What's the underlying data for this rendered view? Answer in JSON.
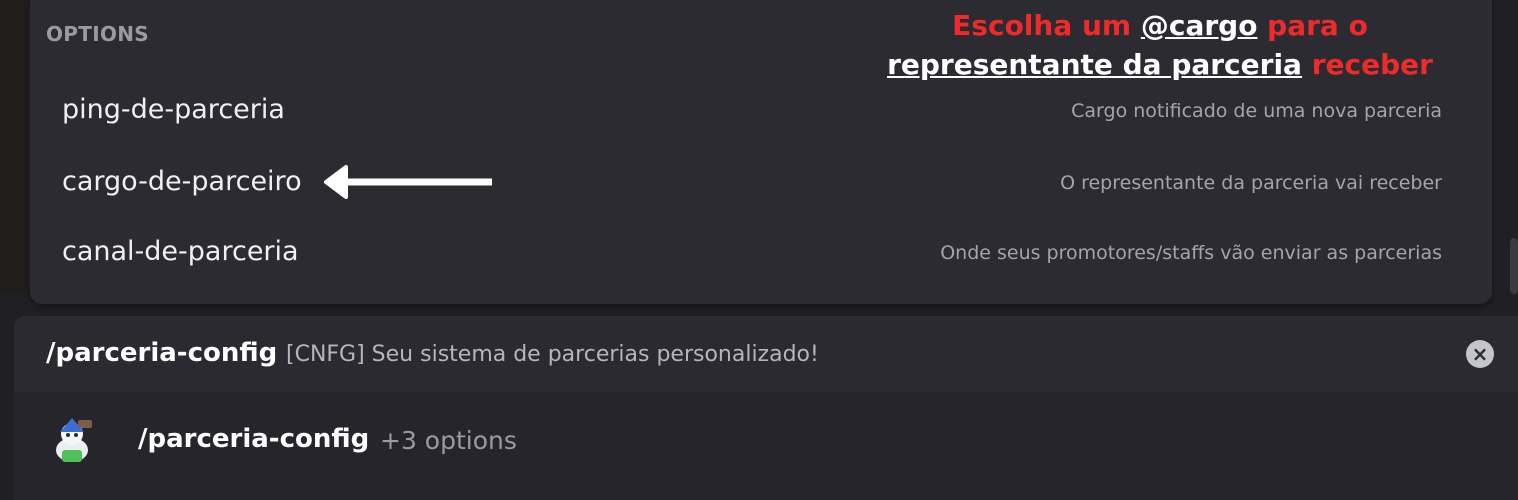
{
  "options_panel": {
    "header": "OPTIONS",
    "items": [
      {
        "name": "ping-de-parceria",
        "description": "Cargo notificado de uma nova parceria"
      },
      {
        "name": "cargo-de-parceiro",
        "description": "O representante da parceria vai receber"
      },
      {
        "name": "canal-de-parceria",
        "description": "Onde seus promotores/staffs vão enviar as parcerias"
      }
    ]
  },
  "annotation": {
    "part1": "Escolha um ",
    "part2": "@cargo",
    "part3": " para o ",
    "part4": "representante da parceria",
    "part5": " receber",
    "colors": {
      "text": "#ee2a2a",
      "highlight": "#ffffff"
    }
  },
  "command": {
    "title": "/parceria-config",
    "description": "[CNFG] Seu sistema de parcerias personalizado!",
    "close_icon": "close-circle-icon",
    "row": {
      "name": "/parceria-config",
      "options_count": "+3 options",
      "avatar_icon": "bot-avatar-icon"
    }
  },
  "colors": {
    "background": "#1f1f24",
    "panel": "#2b2b31",
    "accent_red": "#ee2a2a"
  }
}
